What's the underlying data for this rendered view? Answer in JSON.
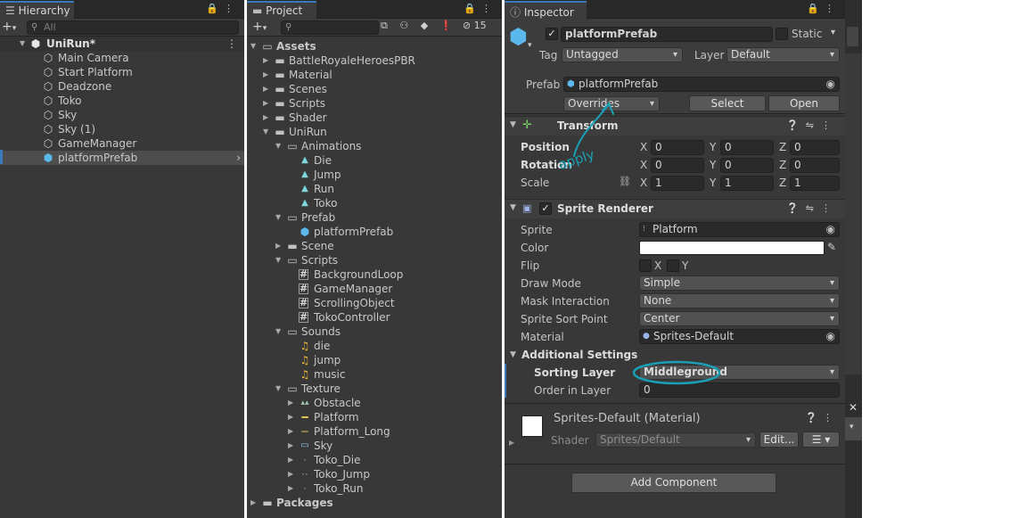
{
  "hierarchy": {
    "tab": "Hierarchy",
    "search_placeholder": "All",
    "scene": "UniRun*",
    "items": [
      "Main Camera",
      "Start Platform",
      "Deadzone",
      "Toko",
      "Sky",
      "Sky (1)",
      "GameManager",
      "platformPrefab"
    ]
  },
  "project": {
    "tab": "Project",
    "hidden_count": "15",
    "root": "Assets",
    "assets": [
      "BattleRoyaleHeroesPBR",
      "Material",
      "Scenes",
      "Scripts",
      "Shader",
      "UniRun"
    ],
    "unirun": {
      "animations": "Animations",
      "anim_items": [
        "Die",
        "Jump",
        "Run",
        "Toko"
      ],
      "prefab": "Prefab",
      "prefab_items": [
        "platformPrefab"
      ],
      "scene": "Scene",
      "scripts": "Scripts",
      "script_items": [
        "BackgroundLoop",
        "GameManager",
        "ScrollingObject",
        "TokoController"
      ],
      "sounds": "Sounds",
      "sound_items": [
        "die",
        "jump",
        "music"
      ],
      "texture": "Texture",
      "texture_items": [
        "Obstacle",
        "Platform",
        "Platform_Long",
        "Sky",
        "Toko_Die",
        "Toko_Jump",
        "Toko_Run"
      ]
    },
    "packages": "Packages"
  },
  "inspector": {
    "tab": "Inspector",
    "object_name": "platformPrefab",
    "static_label": "Static",
    "tag_label": "Tag",
    "tag_value": "Untagged",
    "layer_label": "Layer",
    "layer_value": "Default",
    "prefab_label": "Prefab",
    "prefab_value": "platformPrefab",
    "overrides_label": "Overrides",
    "select_label": "Select",
    "open_label": "Open",
    "annotation_apply": "apply",
    "transform": {
      "title": "Transform",
      "position_label": "Position",
      "rotation_label": "Rotation",
      "scale_label": "Scale",
      "position": [
        "0",
        "0",
        "0"
      ],
      "rotation": [
        "0",
        "0",
        "0"
      ],
      "scale": [
        "1",
        "1",
        "1"
      ],
      "axes": [
        "X",
        "Y",
        "Z"
      ]
    },
    "sprite_renderer": {
      "title": "Sprite Renderer",
      "sprite_label": "Sprite",
      "sprite_value": "Platform",
      "color_label": "Color",
      "color_value": "#ffffff",
      "flip_label": "Flip",
      "flip_x": "X",
      "flip_y": "Y",
      "draw_mode_label": "Draw Mode",
      "draw_mode_value": "Simple",
      "mask_label": "Mask Interaction",
      "mask_value": "None",
      "sort_point_label": "Sprite Sort Point",
      "sort_point_value": "Center",
      "material_label": "Material",
      "material_value": "Sprites-Default",
      "additional_label": "Additional Settings",
      "sorting_layer_label": "Sorting Layer",
      "sorting_layer_value": "Middleground",
      "order_label": "Order in Layer",
      "order_value": "0"
    },
    "material": {
      "title": "Sprites-Default (Material)",
      "shader_label": "Shader",
      "shader_value": "Sprites/Default",
      "edit_label": "Edit..."
    },
    "add_component_label": "Add Component"
  },
  "colors": {
    "panel_bg": "#383838",
    "accent_blue": "#3a79bb",
    "annotation_cyan": "#1a9fb5"
  }
}
